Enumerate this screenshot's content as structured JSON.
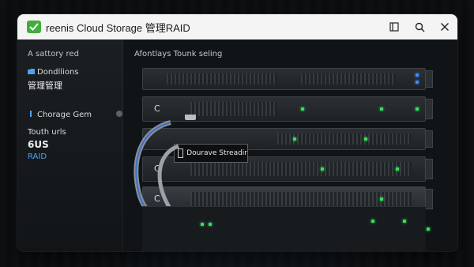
{
  "window": {
    "title": "reenis Cloud Storage 管理RAID",
    "controls": {
      "restore_icon": "restore-icon",
      "search_icon": "search-icon",
      "close_icon": "close-icon"
    }
  },
  "sidebar": {
    "heading": "A sattory red",
    "item_conditions": "Dondllions",
    "item_management": "管理管理",
    "item_storage": "Chorage Gem",
    "item_touch": "Touth urls",
    "item_count": "6US",
    "item_raid": "RAID"
  },
  "main": {
    "heading": "Afontlays Tounk seling",
    "port_labels": [
      "C",
      "C",
      "C"
    ],
    "overlay": "Dourave Streadir"
  },
  "colors": {
    "accent_green": "#3fae3a",
    "led_green": "#36e05a",
    "link_blue": "#4ea3f0"
  }
}
